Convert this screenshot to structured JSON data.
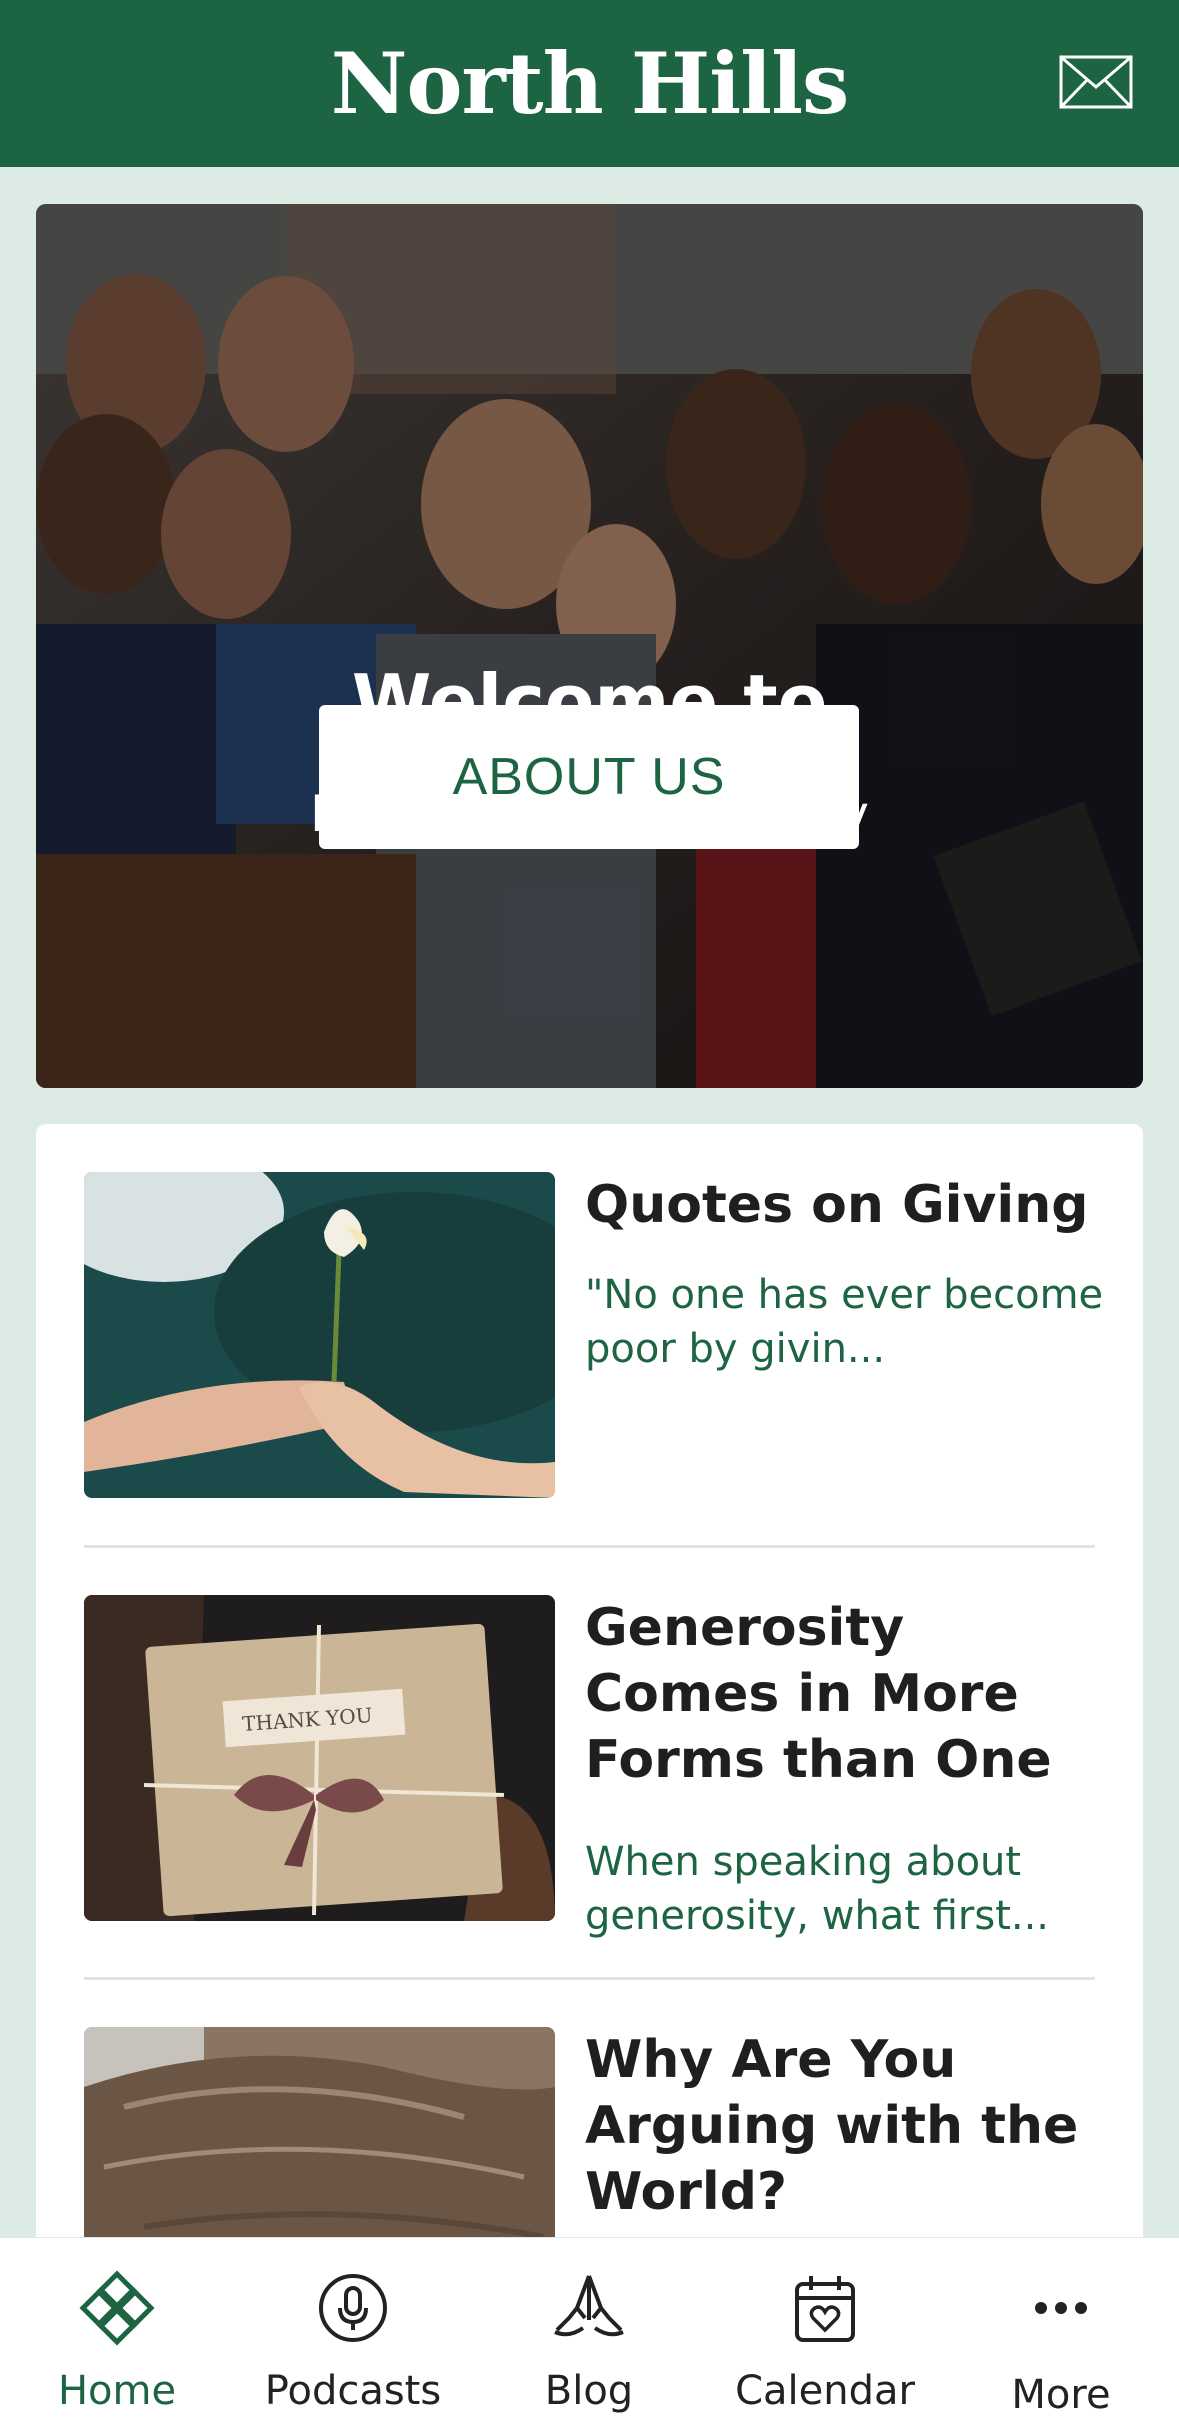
{
  "header": {
    "brand": "North Hills",
    "mail_icon": "mail-icon"
  },
  "hero": {
    "title": "Welcome to",
    "subtitle": "North Hills community",
    "button_label": "ABOUT US"
  },
  "articles": [
    {
      "title": "Quotes on Giving",
      "excerpt": "\"No one has ever become poor by givin...",
      "image": "flower-handoff-photo"
    },
    {
      "title": "Generosity Comes in More Forms than One",
      "excerpt": "When speaking about generosity, what first...",
      "image": "thank-you-gift-photo",
      "image_text": "THANK YOU"
    },
    {
      "title": "Why Are You Arguing with the World?",
      "excerpt": "",
      "image": "animal-fur-photo"
    }
  ],
  "bottom_nav": {
    "items": [
      {
        "label": "Home",
        "icon": "home-knot-icon",
        "active": true
      },
      {
        "label": "Podcasts",
        "icon": "microphone-icon",
        "active": false
      },
      {
        "label": "Blog",
        "icon": "praying-hands-icon",
        "active": false
      },
      {
        "label": "Calendar",
        "icon": "calendar-heart-icon",
        "active": false
      },
      {
        "label": "More",
        "icon": "more-dots-icon",
        "active": false
      }
    ]
  },
  "colors": {
    "brand_green": "#1d6443",
    "page_background": "#dcebe4",
    "card_background": "#ffffff"
  }
}
